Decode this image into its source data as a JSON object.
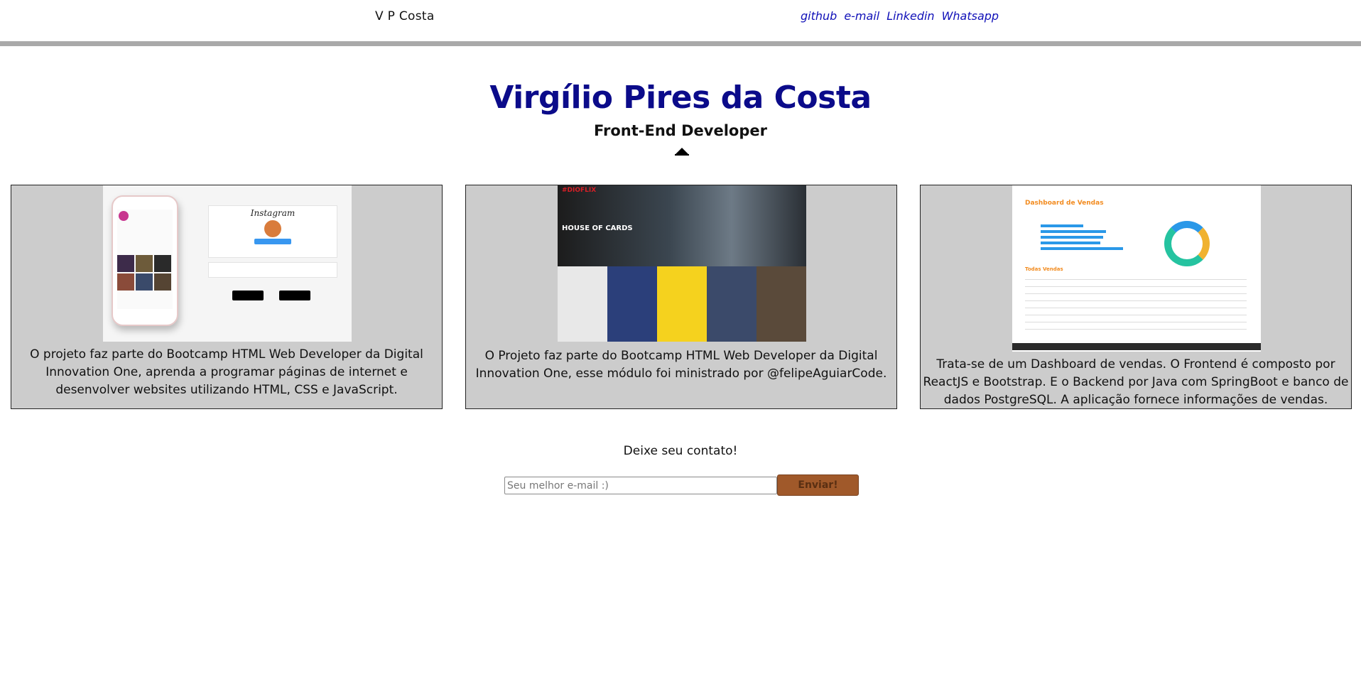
{
  "header": {
    "brand": "V P Costa",
    "links": [
      "github",
      "e-mail",
      "Linkedin",
      "Whatsapp"
    ]
  },
  "hero": {
    "name": "Virgílio Pires da Costa",
    "role": "Front-End Developer"
  },
  "projects": [
    {
      "thumbnail": "instagram-clone-screenshot",
      "description": "O projeto faz parte do Bootcamp HTML Web Developer da Digital Innovation One, aprenda a programar páginas de internet e desenvolver websites utilizando HTML, CSS e JavaScript."
    },
    {
      "thumbnail": "dioflix-screenshot",
      "thumb_text": {
        "logo": "#DIOFLIX",
        "title": "HOUSE OF CARDS"
      },
      "description": "O Projeto faz parte do Bootcamp HTML Web Developer da Digital Innovation One, esse módulo foi ministrado por @felipeAguiarCode."
    },
    {
      "thumbnail": "sales-dashboard-screenshot",
      "thumb_text": {
        "title": "Dashboard de Vendas",
        "table_title": "Todas Vendas"
      },
      "description": "Trata-se de um Dashboard de vendas. O Frontend é composto por ReactJS e Bootstrap. E o Backend por Java com SpringBoot e banco de dados PostgreSQL. A aplicação fornece informações de vendas."
    }
  ],
  "contact": {
    "label": "Deixe seu contato!",
    "email_placeholder": "Seu melhor e-mail :)",
    "email_value": "",
    "submit_label": "Enviar!"
  },
  "colors": {
    "title": "#0b0b8a",
    "links": "#1010b8",
    "card_bg": "#cccccc",
    "button": "#a0592a"
  }
}
